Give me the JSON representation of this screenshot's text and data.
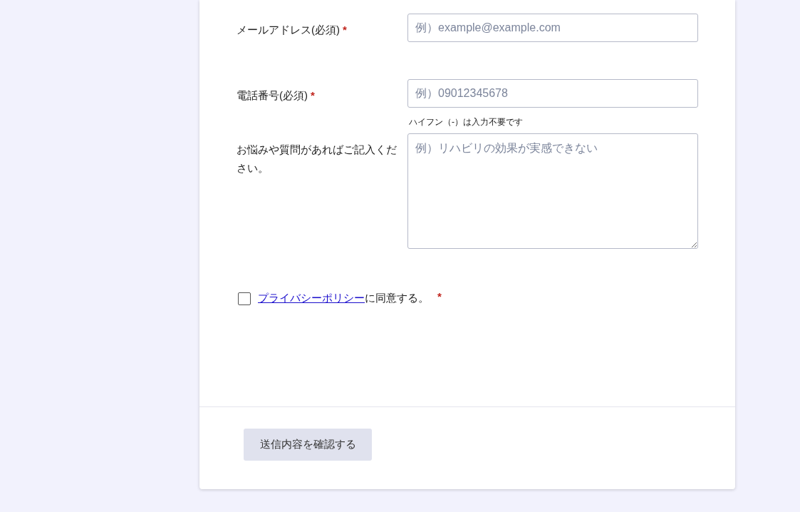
{
  "fields": [
    {
      "kind": "input",
      "label": "メールアドレス(必須)",
      "required_mark": "*",
      "placeholder": "例）example@example.com"
    },
    {
      "kind": "input",
      "label": "電話番号(必須)",
      "required_mark": "*",
      "placeholder": "例）09012345678",
      "hint": "ハイフン（-）は入力不要です"
    },
    {
      "kind": "textarea",
      "label": "お悩みや質問があればご記入ください。",
      "placeholder": "例）リハビリの効果が実感できない"
    }
  ],
  "consent": {
    "checked": false,
    "link": "プライバシーポリシー",
    "text": "に同意する。",
    "required_mark": "*"
  },
  "submit": {
    "label": "送信内容を確認する"
  }
}
